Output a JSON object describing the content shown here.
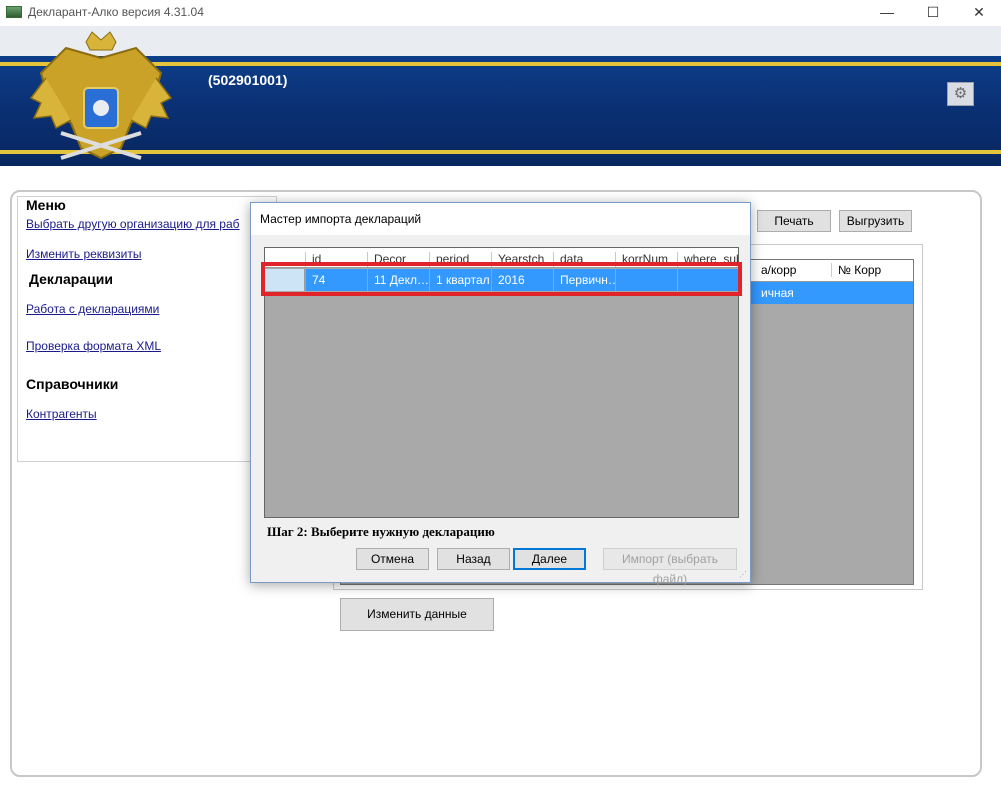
{
  "window": {
    "title": "Декларант-Алко версия 4.31.04",
    "minimize": "—",
    "maximize": "☐",
    "close": "✕"
  },
  "header": {
    "org_code": "(502901001)",
    "settings_icon": "gear-icon"
  },
  "menu": {
    "title": "Меню",
    "items": [
      {
        "label": "Выбрать другую организацию для раб"
      },
      {
        "label": "Изменить реквизиты"
      }
    ],
    "declarations_title": "Декларации",
    "declarations_items": [
      {
        "label": "Работа с декларациями"
      },
      {
        "label": "Проверка формата XML"
      }
    ],
    "reference_title": "Справочники",
    "reference_items": [
      {
        "label": "Контрагенты"
      }
    ]
  },
  "toolbar": {
    "print_label": "Печать",
    "export_label": "Выгрузить"
  },
  "bg_table": {
    "headers": [
      "а/корр",
      "№ Корр"
    ],
    "selected_row": [
      "ичная",
      ""
    ]
  },
  "change_button_label": "Изменить данные",
  "dialog": {
    "title": "Мастер импорта деклараций",
    "columns": [
      "id",
      "Decor",
      "period",
      "Yearstch",
      "data",
      "korrNum",
      "where_subj"
    ],
    "rows": [
      [
        "74",
        "11 Декл…",
        "1 квартал",
        "2016",
        "Первичн…",
        "",
        ""
      ]
    ],
    "step_text": "Шаг 2: Выберите нужную декларацию",
    "cancel_label": "Отмена",
    "back_label": "Назад",
    "next_label": "Далее",
    "import_label": "Импорт (выбрать файл)"
  },
  "colors": {
    "banner_blue": "#0a2f73",
    "stripe_gold": "#e3c43a",
    "selection": "#3399ff",
    "highlight_red": "#e0242a"
  }
}
